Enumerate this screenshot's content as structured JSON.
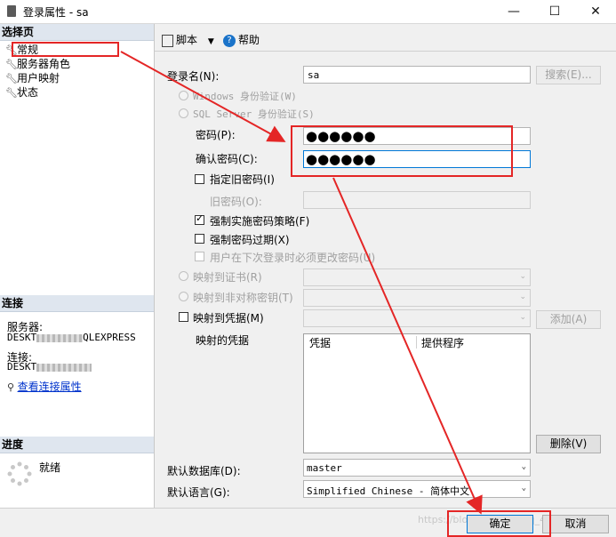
{
  "window": {
    "title": "登录属性 - sa",
    "minimize": "—",
    "maximize": "☐",
    "close": "✕"
  },
  "left": {
    "select_page_header": "选择页",
    "nav": [
      {
        "label": "常规",
        "icon": "wrench-icon"
      },
      {
        "label": "服务器角色",
        "icon": "wrench-icon"
      },
      {
        "label": "用户映射",
        "icon": "wrench-icon"
      },
      {
        "label": "状态",
        "icon": "wrench-icon"
      }
    ],
    "connection_header": "连接",
    "server_label": "服务器:",
    "server_value_prefix": "DESKT",
    "server_value_suffix": "QLEXPRESS",
    "connect_label": "连接:",
    "connect_value_prefix": "DESKT",
    "view_connection_props": "查看连接属性",
    "progress_header": "进度",
    "progress_status": "就绪"
  },
  "toolbar": {
    "script_label": "脚本",
    "help_label": "帮助"
  },
  "form": {
    "login_name_label": "登录名(N):",
    "login_name_value": "sa",
    "search_button": "搜索(E)...",
    "windows_auth": "Windows 身份验证(W)",
    "sql_auth": "SQL Server 身份验证(S)",
    "password_label": "密码(P):",
    "password_value": "●●●●●●",
    "confirm_label": "确认密码(C):",
    "confirm_value": "●●●●●●",
    "specify_old_pw": "指定旧密码(I)",
    "old_pw_label": "旧密码(O):",
    "enforce_policy": "强制实施密码策略(F)",
    "enforce_expiration": "强制密码过期(X)",
    "must_change": "用户在下次登录时必须更改密码(U)",
    "map_cert": "映射到证书(R)",
    "map_asym": "映射到非对称密钥(T)",
    "map_cred": "映射到凭据(M)",
    "add_button": "添加(A)",
    "mapped_creds_label": "映射的凭据",
    "cred_col": "凭据",
    "provider_col": "提供程序",
    "remove_button": "删除(V)",
    "default_db_label": "默认数据库(D):",
    "default_db_value": "master",
    "default_lang_label": "默认语言(G):",
    "default_lang_value": "Simplified Chinese - 简体中文"
  },
  "footer": {
    "ok_button": "确定",
    "cancel_button": "取消",
    "watermark": "https://blog.csdn.net/qq_41657719"
  },
  "colors": {
    "annotation_red": "#e42626",
    "pane_header_bg": "#dfe6ef",
    "link_blue": "#0033cc"
  }
}
